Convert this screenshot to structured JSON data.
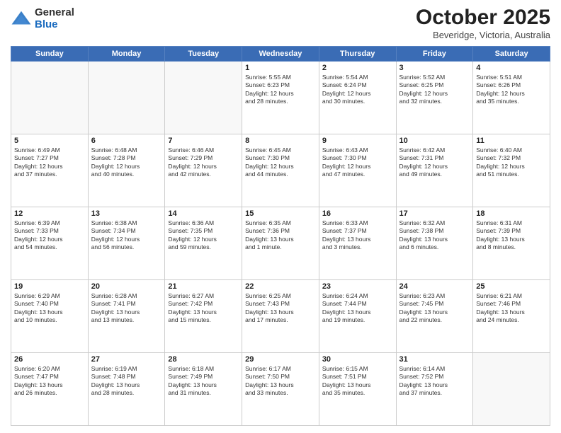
{
  "header": {
    "logo_general": "General",
    "logo_blue": "Blue",
    "month": "October 2025",
    "location": "Beveridge, Victoria, Australia"
  },
  "days_of_week": [
    "Sunday",
    "Monday",
    "Tuesday",
    "Wednesday",
    "Thursday",
    "Friday",
    "Saturday"
  ],
  "weeks": [
    [
      {
        "day": "",
        "info": ""
      },
      {
        "day": "",
        "info": ""
      },
      {
        "day": "",
        "info": ""
      },
      {
        "day": "1",
        "info": "Sunrise: 5:55 AM\nSunset: 6:23 PM\nDaylight: 12 hours\nand 28 minutes."
      },
      {
        "day": "2",
        "info": "Sunrise: 5:54 AM\nSunset: 6:24 PM\nDaylight: 12 hours\nand 30 minutes."
      },
      {
        "day": "3",
        "info": "Sunrise: 5:52 AM\nSunset: 6:25 PM\nDaylight: 12 hours\nand 32 minutes."
      },
      {
        "day": "4",
        "info": "Sunrise: 5:51 AM\nSunset: 6:26 PM\nDaylight: 12 hours\nand 35 minutes."
      }
    ],
    [
      {
        "day": "5",
        "info": "Sunrise: 6:49 AM\nSunset: 7:27 PM\nDaylight: 12 hours\nand 37 minutes."
      },
      {
        "day": "6",
        "info": "Sunrise: 6:48 AM\nSunset: 7:28 PM\nDaylight: 12 hours\nand 40 minutes."
      },
      {
        "day": "7",
        "info": "Sunrise: 6:46 AM\nSunset: 7:29 PM\nDaylight: 12 hours\nand 42 minutes."
      },
      {
        "day": "8",
        "info": "Sunrise: 6:45 AM\nSunset: 7:30 PM\nDaylight: 12 hours\nand 44 minutes."
      },
      {
        "day": "9",
        "info": "Sunrise: 6:43 AM\nSunset: 7:30 PM\nDaylight: 12 hours\nand 47 minutes."
      },
      {
        "day": "10",
        "info": "Sunrise: 6:42 AM\nSunset: 7:31 PM\nDaylight: 12 hours\nand 49 minutes."
      },
      {
        "day": "11",
        "info": "Sunrise: 6:40 AM\nSunset: 7:32 PM\nDaylight: 12 hours\nand 51 minutes."
      }
    ],
    [
      {
        "day": "12",
        "info": "Sunrise: 6:39 AM\nSunset: 7:33 PM\nDaylight: 12 hours\nand 54 minutes."
      },
      {
        "day": "13",
        "info": "Sunrise: 6:38 AM\nSunset: 7:34 PM\nDaylight: 12 hours\nand 56 minutes."
      },
      {
        "day": "14",
        "info": "Sunrise: 6:36 AM\nSunset: 7:35 PM\nDaylight: 12 hours\nand 59 minutes."
      },
      {
        "day": "15",
        "info": "Sunrise: 6:35 AM\nSunset: 7:36 PM\nDaylight: 13 hours\nand 1 minute."
      },
      {
        "day": "16",
        "info": "Sunrise: 6:33 AM\nSunset: 7:37 PM\nDaylight: 13 hours\nand 3 minutes."
      },
      {
        "day": "17",
        "info": "Sunrise: 6:32 AM\nSunset: 7:38 PM\nDaylight: 13 hours\nand 6 minutes."
      },
      {
        "day": "18",
        "info": "Sunrise: 6:31 AM\nSunset: 7:39 PM\nDaylight: 13 hours\nand 8 minutes."
      }
    ],
    [
      {
        "day": "19",
        "info": "Sunrise: 6:29 AM\nSunset: 7:40 PM\nDaylight: 13 hours\nand 10 minutes."
      },
      {
        "day": "20",
        "info": "Sunrise: 6:28 AM\nSunset: 7:41 PM\nDaylight: 13 hours\nand 13 minutes."
      },
      {
        "day": "21",
        "info": "Sunrise: 6:27 AM\nSunset: 7:42 PM\nDaylight: 13 hours\nand 15 minutes."
      },
      {
        "day": "22",
        "info": "Sunrise: 6:25 AM\nSunset: 7:43 PM\nDaylight: 13 hours\nand 17 minutes."
      },
      {
        "day": "23",
        "info": "Sunrise: 6:24 AM\nSunset: 7:44 PM\nDaylight: 13 hours\nand 19 minutes."
      },
      {
        "day": "24",
        "info": "Sunrise: 6:23 AM\nSunset: 7:45 PM\nDaylight: 13 hours\nand 22 minutes."
      },
      {
        "day": "25",
        "info": "Sunrise: 6:21 AM\nSunset: 7:46 PM\nDaylight: 13 hours\nand 24 minutes."
      }
    ],
    [
      {
        "day": "26",
        "info": "Sunrise: 6:20 AM\nSunset: 7:47 PM\nDaylight: 13 hours\nand 26 minutes."
      },
      {
        "day": "27",
        "info": "Sunrise: 6:19 AM\nSunset: 7:48 PM\nDaylight: 13 hours\nand 28 minutes."
      },
      {
        "day": "28",
        "info": "Sunrise: 6:18 AM\nSunset: 7:49 PM\nDaylight: 13 hours\nand 31 minutes."
      },
      {
        "day": "29",
        "info": "Sunrise: 6:17 AM\nSunset: 7:50 PM\nDaylight: 13 hours\nand 33 minutes."
      },
      {
        "day": "30",
        "info": "Sunrise: 6:15 AM\nSunset: 7:51 PM\nDaylight: 13 hours\nand 35 minutes."
      },
      {
        "day": "31",
        "info": "Sunrise: 6:14 AM\nSunset: 7:52 PM\nDaylight: 13 hours\nand 37 minutes."
      },
      {
        "day": "",
        "info": ""
      }
    ]
  ]
}
